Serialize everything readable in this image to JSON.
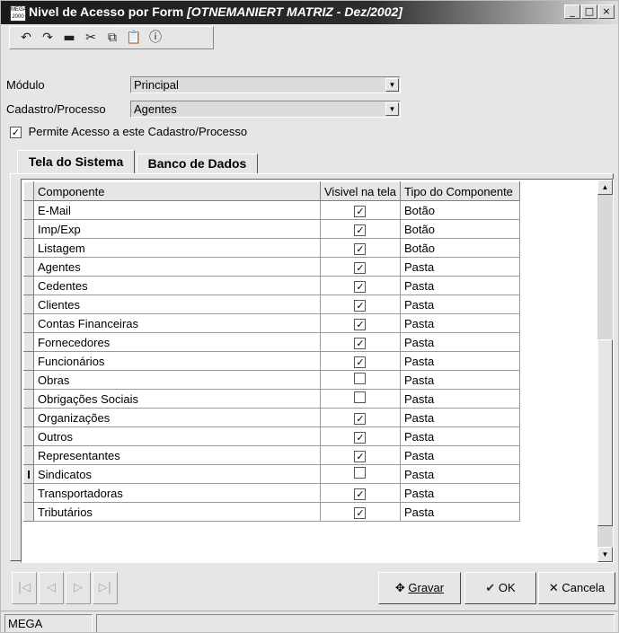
{
  "window": {
    "logo_text": "MEGA 2000",
    "title": "Nivel de Acesso por Form",
    "subtitle": "[OTNEMANIERT MATRIZ - Dez/2002]",
    "minimize": "_",
    "maximize": "□",
    "close": "×"
  },
  "toolbar": {
    "undo": "↶",
    "redo": "↷",
    "delete": "▬",
    "cut": "✂",
    "copy": "⧉",
    "paste": "📋",
    "info": "ⓘ"
  },
  "form": {
    "modulo_label": "Módulo",
    "modulo_value": "Principal",
    "cadastro_label": "Cadastro/Processo",
    "cadastro_value": "Agentes",
    "permite_label": "Permite Acesso a este Cadastro/Processo",
    "permite_checked": true
  },
  "tabs": [
    {
      "label": "Tela do Sistema",
      "active": true
    },
    {
      "label": "Banco de Dados",
      "active": false
    }
  ],
  "grid": {
    "columns": [
      "Componente",
      "Visivel na tela",
      "Tipo do Componente"
    ],
    "rows": [
      {
        "componente": "E-Mail",
        "visivel": true,
        "tipo": "Botão"
      },
      {
        "componente": "Imp/Exp",
        "visivel": true,
        "tipo": "Botão"
      },
      {
        "componente": "Listagem",
        "visivel": true,
        "tipo": "Botão"
      },
      {
        "componente": "Agentes",
        "visivel": true,
        "tipo": "Pasta"
      },
      {
        "componente": "Cedentes",
        "visivel": true,
        "tipo": "Pasta"
      },
      {
        "componente": "Clientes",
        "visivel": true,
        "tipo": "Pasta"
      },
      {
        "componente": "Contas Financeiras",
        "visivel": true,
        "tipo": "Pasta"
      },
      {
        "componente": "Fornecedores",
        "visivel": true,
        "tipo": "Pasta"
      },
      {
        "componente": "Funcionários",
        "visivel": true,
        "tipo": "Pasta"
      },
      {
        "componente": "Obras",
        "visivel": false,
        "tipo": "Pasta"
      },
      {
        "componente": "Obrigações Sociais",
        "visivel": false,
        "tipo": "Pasta"
      },
      {
        "componente": "Organizações",
        "visivel": true,
        "tipo": "Pasta"
      },
      {
        "componente": "Outros",
        "visivel": true,
        "tipo": "Pasta"
      },
      {
        "componente": "Representantes",
        "visivel": true,
        "tipo": "Pasta"
      },
      {
        "componente": "Sindicatos",
        "visivel": false,
        "tipo": "Pasta"
      },
      {
        "componente": "Transportadoras",
        "visivel": true,
        "tipo": "Pasta"
      },
      {
        "componente": "Tributários",
        "visivel": true,
        "tipo": "Pasta"
      }
    ],
    "current_row_marker": "I"
  },
  "nav": {
    "first": "|◁",
    "prev": "◁",
    "next": "▷",
    "last": "▷|"
  },
  "buttons": {
    "gravar": "Gravar",
    "gravar_icon": "✥",
    "ok": "OK",
    "ok_icon": "✔",
    "cancela": "Cancela",
    "cancela_icon": "✕"
  },
  "status": {
    "panel1": "MEGA"
  }
}
